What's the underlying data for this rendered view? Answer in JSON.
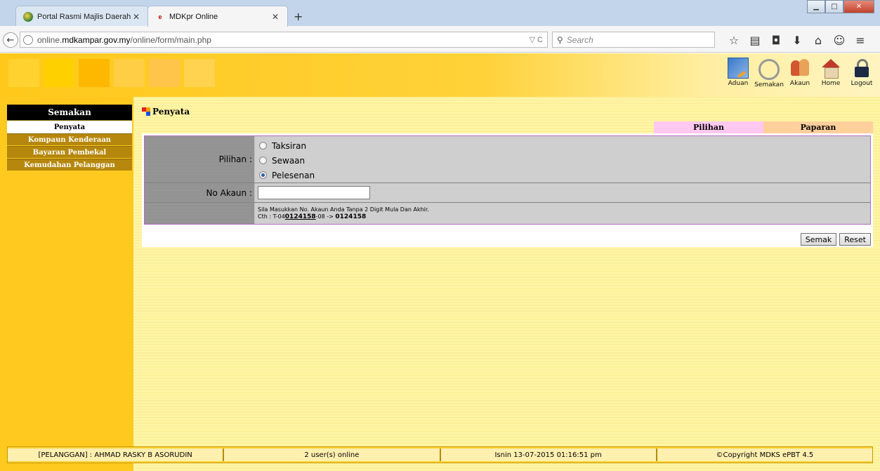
{
  "browser": {
    "tabs": [
      {
        "label": "Portal Rasmi Majlis Daerah ..."
      },
      {
        "label": "MDKpr Online"
      }
    ],
    "new_tab_symbol": "+",
    "url_prefix": "online.",
    "url_domain": "mdkampar.gov.my",
    "url_path": "/online/form/main.php",
    "url_tools": "▽ C",
    "search_placeholder": "Search",
    "nav_icons": [
      "star-icon",
      "bookmarks-icon",
      "pocket-icon",
      "download-icon",
      "home-icon",
      "chat-icon",
      "menu-icon"
    ]
  },
  "header": {
    "blocks": [
      "#ffd22f",
      "#ffd000",
      "#ffb800",
      "#ffce45",
      "#ffc54a",
      "#ffd24f"
    ],
    "icons": [
      {
        "name": "aduan",
        "label": "Aduan"
      },
      {
        "name": "semakan",
        "label": "Semakan"
      },
      {
        "name": "akaun",
        "label": "Akaun"
      },
      {
        "name": "home",
        "label": "Home"
      },
      {
        "name": "logout",
        "label": "Logout"
      }
    ]
  },
  "sidebar": {
    "title": "Semakan",
    "items": [
      {
        "label": "Penyata",
        "active": true
      },
      {
        "label": "Kompaun Kenderaan"
      },
      {
        "label": "Bayaran Pembekal"
      },
      {
        "label": "Kemudahan Pelanggan"
      }
    ]
  },
  "main": {
    "section_title": "Penyata",
    "tabs": [
      {
        "label": "Pilihan",
        "color": "#ffc8f0"
      },
      {
        "label": "Paparan",
        "color": "#ffcf9c"
      }
    ],
    "form": {
      "pilihan_label": "Pilihan :",
      "options": [
        {
          "label": "Taksiran",
          "checked": false
        },
        {
          "label": "Sewaan",
          "checked": false
        },
        {
          "label": "Pelesenan",
          "checked": true
        }
      ],
      "no_akaun_label": "No Akaun :",
      "no_akaun_value": "",
      "note_line1": "Sila Masukkan No. Akaun Anda Tanpa 2 Digit Mula Dan Akhir.",
      "note_prefix": "Cth : T-04",
      "note_example": "0124158",
      "note_suffix": "-08 -> ",
      "note_result": "0124158"
    },
    "buttons": {
      "semak": "Semak",
      "reset": "Reset"
    }
  },
  "footer": {
    "cells": [
      "[PELANGGAN] : AHMAD RASKY B ASORUDIN",
      "2 user(s) online",
      "Isnin 13-07-2015 01:16:51 pm",
      "©Copyright MDKS ePBT 4.5"
    ]
  },
  "colors": {
    "page_bg": "#fff6a8",
    "sidebar": "#ffc91f",
    "sidebar_item": "#b5870c",
    "form_border": "#b36bc4"
  }
}
